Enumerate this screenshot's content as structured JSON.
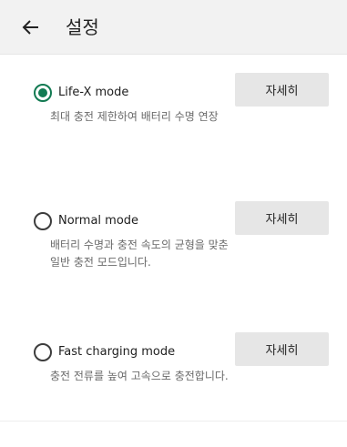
{
  "app_bar": {
    "back_icon": "arrow-left-icon",
    "title": "설정"
  },
  "colors": {
    "accent": "#127a52",
    "app_bar_bg": "#f2f2f2",
    "button_bg": "#e6e6e6"
  },
  "options": [
    {
      "title": "Life-X mode",
      "description": "최대 충전 제한하여 배터리 수명 연장",
      "selected": true,
      "button_label": "자세히"
    },
    {
      "title": "Normal mode",
      "description": "배터리 수명과 충전 속도의 균형을 맞춘 일반 충전 모드입니다.",
      "selected": false,
      "button_label": "자세히"
    },
    {
      "title": "Fast charging mode",
      "description": "충전 전류를 높여 고속으로 충전합니다.",
      "selected": false,
      "button_label": "자세히"
    }
  ]
}
